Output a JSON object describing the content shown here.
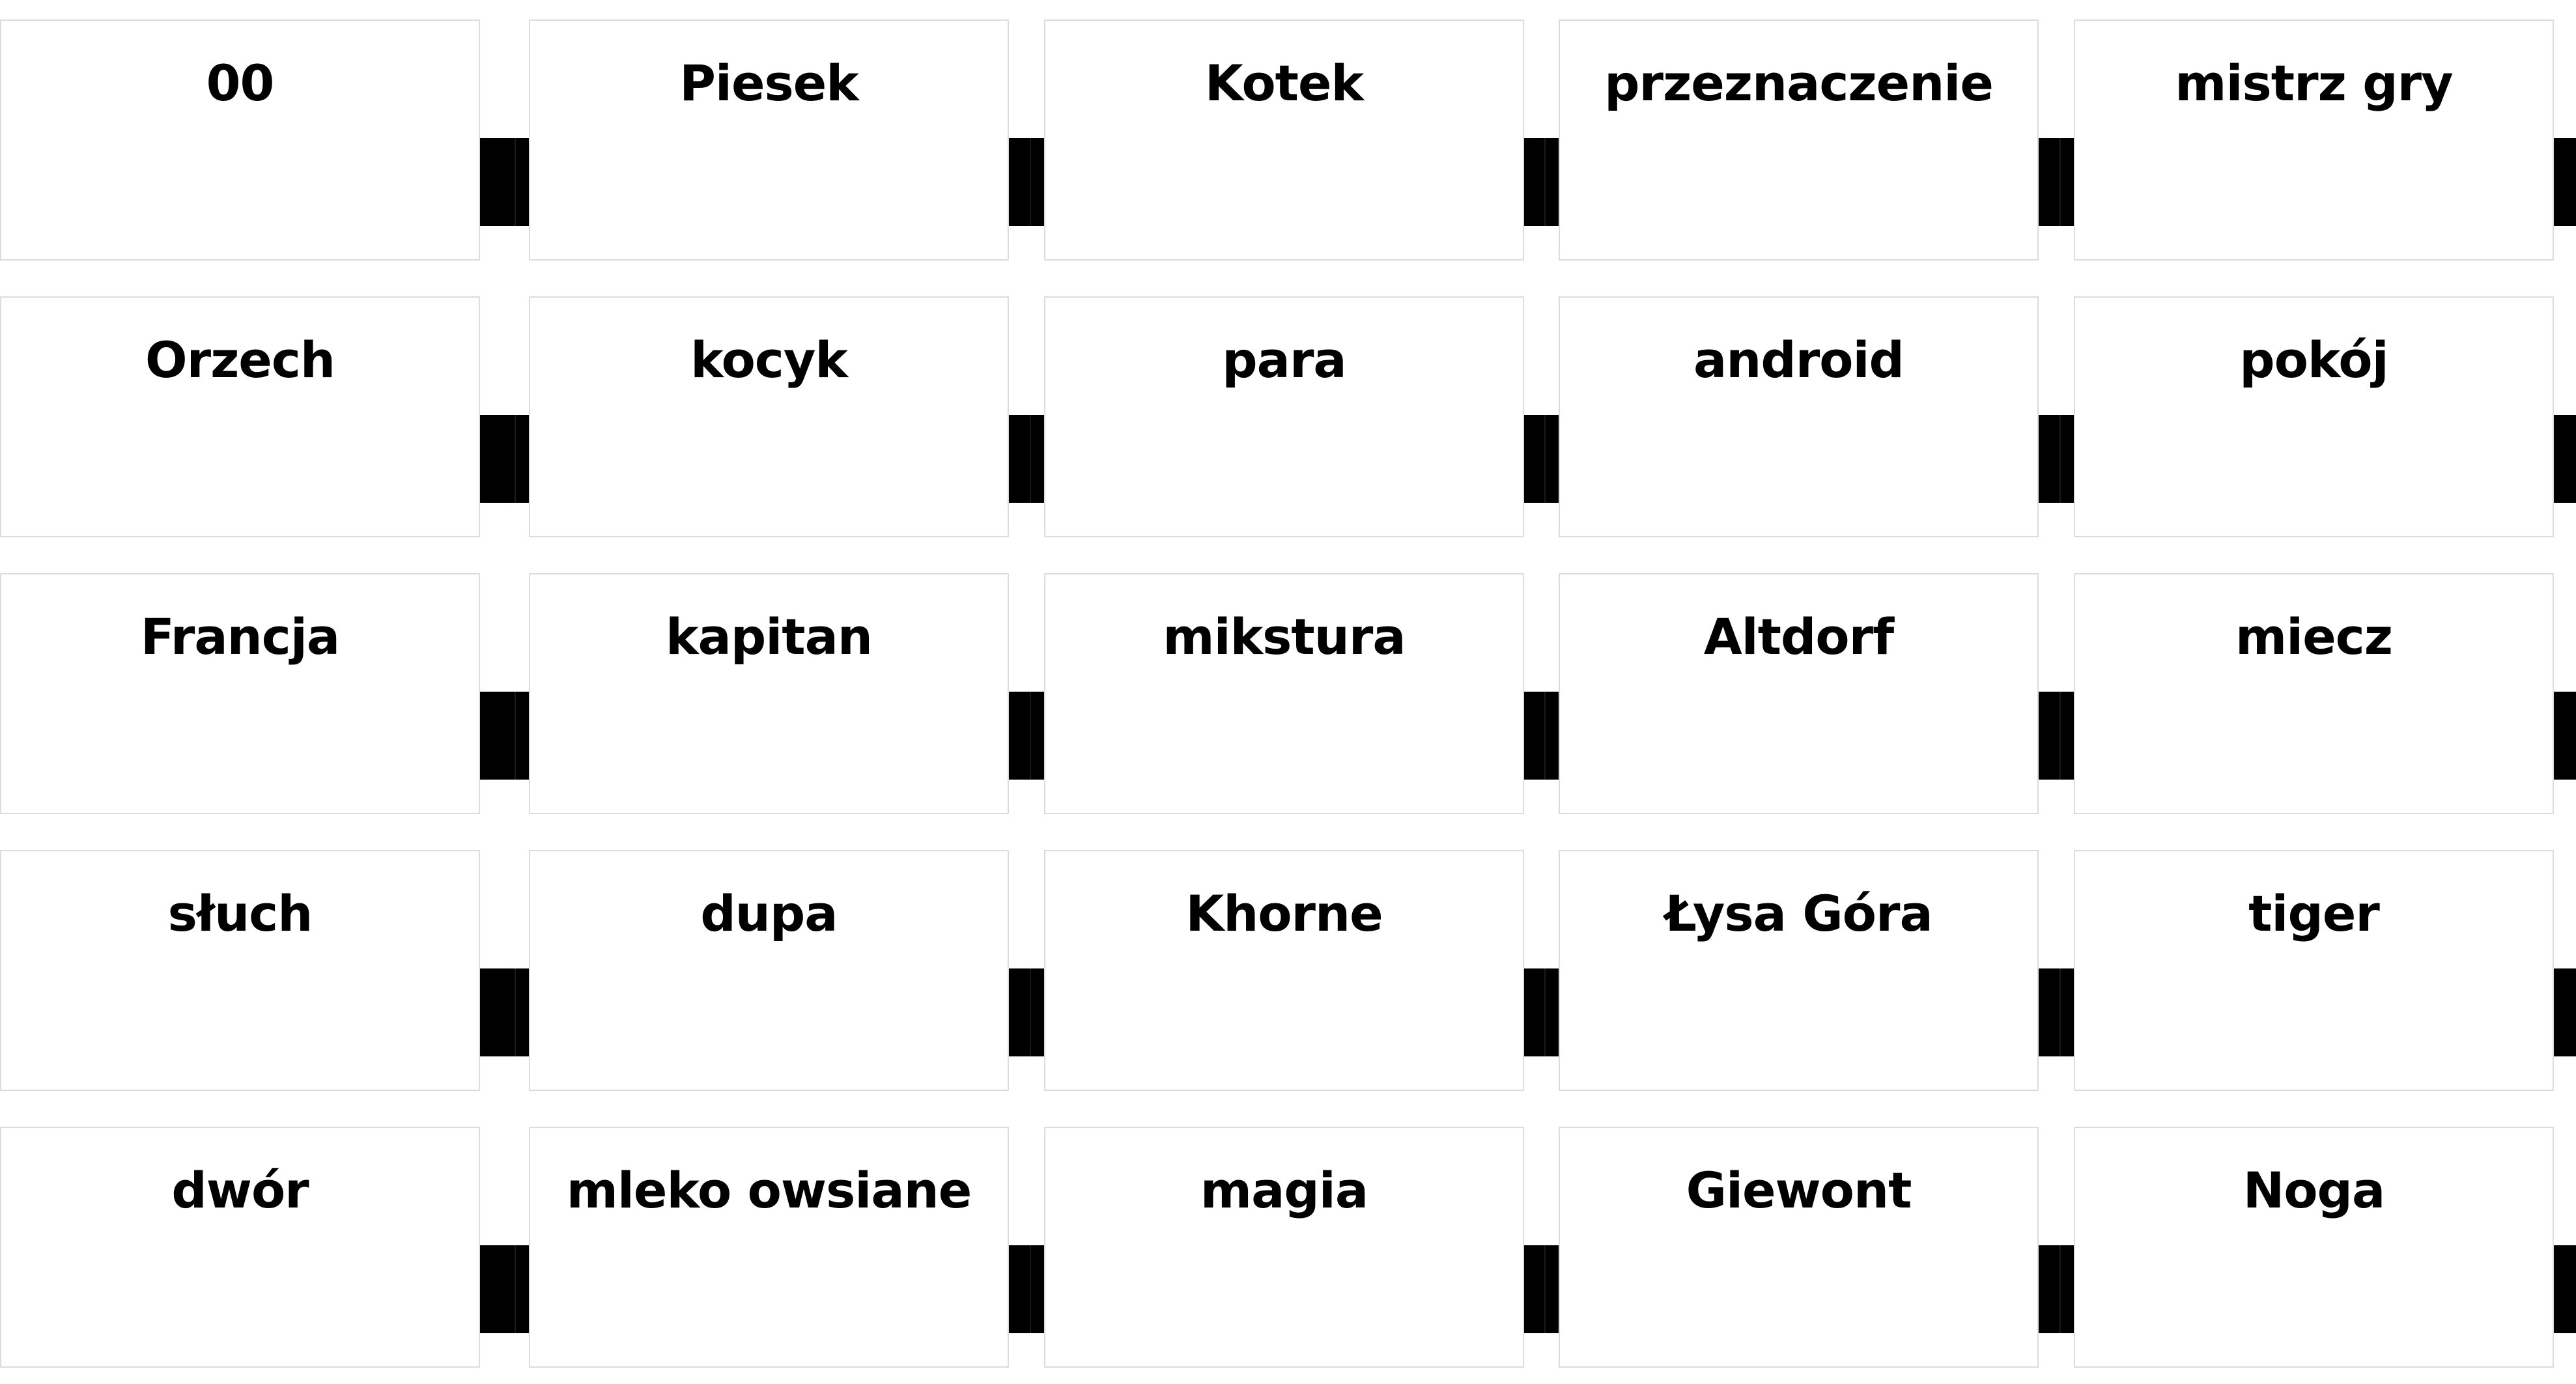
{
  "cards": [
    [
      "Piesek",
      "Kotek",
      "przeznaczenie",
      "mistrz gry",
      "00"
    ],
    [
      "kocyk",
      "para",
      "android",
      "pokój",
      "Orzech"
    ],
    [
      "kapitan",
      "mikstura",
      "Altdorf",
      "miecz",
      "Francja"
    ],
    [
      "dupa",
      "Khorne",
      "Łysa Góra",
      "tiger",
      "słuch"
    ],
    [
      "mleko owsiane",
      "magia",
      "Giewont",
      "Noga",
      "dwór"
    ]
  ],
  "colors": {
    "background": "#ffffff",
    "band": "#000000",
    "text": "#000000",
    "flipped_text": "#ffffff",
    "card_border": "#dcdcdc"
  }
}
